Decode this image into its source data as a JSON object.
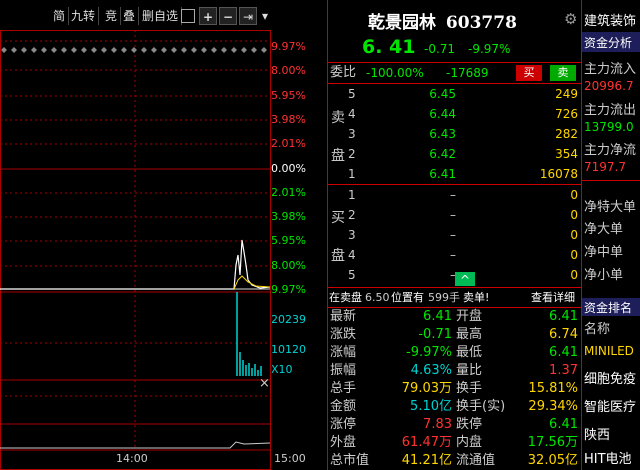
{
  "toolbar": {
    "btn1": "简",
    "btn2": "九转",
    "btn3": "竞",
    "btn4": "叠",
    "btn5": "删自选",
    "menu_icon": "menu-icon",
    "plus": "+",
    "minus": "−",
    "expand": "⇥",
    "dropdown": "▾"
  },
  "chart": {
    "y_labels_up": [
      "9.97%",
      "8.00%",
      "5.95%",
      "3.98%",
      "2.01%",
      "0.00%"
    ],
    "y_labels_down": [
      "2.01%",
      "3.98%",
      "5.95%",
      "8.00%",
      "9.97%"
    ],
    "vol_labels": [
      "20239",
      "10120",
      "X10"
    ],
    "time_labels": [
      "14:00",
      "15:00"
    ],
    "close_icon": "×"
  },
  "quote": {
    "name": "乾景园林",
    "code": "603778",
    "price": "6. 41",
    "change": "-0.71",
    "pct": "-9.97%",
    "weibi_label": "委比",
    "weibi_val": "-100.00%",
    "weicha_val": "-17689",
    "buy_btn": "买",
    "sell_btn": "卖",
    "sell_side": [
      "卖",
      "盘"
    ],
    "sells": [
      {
        "lvl": "5",
        "price": "6.45",
        "vol": "249"
      },
      {
        "lvl": "4",
        "price": "6.44",
        "vol": "726"
      },
      {
        "lvl": "3",
        "price": "6.43",
        "vol": "282"
      },
      {
        "lvl": "2",
        "price": "6.42",
        "vol": "354"
      },
      {
        "lvl": "1",
        "price": "6.41",
        "vol": "16078"
      }
    ],
    "buy_side": [
      "买",
      "盘"
    ],
    "buys": [
      {
        "lvl": "1",
        "price": "–",
        "vol": "0"
      },
      {
        "lvl": "2",
        "price": "–",
        "vol": "0"
      },
      {
        "lvl": "3",
        "price": "–",
        "vol": "0"
      },
      {
        "lvl": "4",
        "price": "–",
        "vol": "0"
      },
      {
        "lvl": "5",
        "price": "–",
        "vol": "0"
      }
    ],
    "caret": "^",
    "notice_pre": "在卖盘",
    "notice_price": "6.50",
    "notice_mid": "位置有",
    "notice_vol": "599手",
    "notice_post": "卖单!",
    "detail_link": "查看详细",
    "stats": [
      {
        "l1": "最新",
        "v1": "6.41",
        "l2": "开盘",
        "v2": "6.41"
      },
      {
        "l1": "涨跌",
        "v1": "-0.71",
        "l2": "最高",
        "v2": "6.74"
      },
      {
        "l1": "涨幅",
        "v1": "-9.97%",
        "l2": "最低",
        "v2": "6.41"
      },
      {
        "l1": "振幅",
        "v1": "4.63%",
        "l2": "量比",
        "v2": "1.37"
      },
      {
        "l1": "总手",
        "v1": "79.03万",
        "l2": "换手",
        "v2": "15.81%"
      },
      {
        "l1": "金额",
        "v1": "5.10亿",
        "l2": "换手(实)",
        "v2": "29.34%"
      },
      {
        "l1": "涨停",
        "v1": "7.83",
        "l2": "跌停",
        "v2": "6.41"
      },
      {
        "l1": "外盘",
        "v1": "61.47万",
        "l2": "内盘",
        "v2": "17.56万"
      },
      {
        "l1": "总市值",
        "v1": "41.21亿",
        "l2": "流通值",
        "v2": "32.05亿"
      }
    ]
  },
  "sidebar": {
    "top": "建筑装饰",
    "fund_title": "资金分析",
    "items": [
      "主力流入",
      "20996.7",
      "主力流出",
      "13799.0",
      "主力净流",
      "7197.7"
    ],
    "flows": [
      "净特大单",
      "净大单",
      "净中单",
      "净小单"
    ],
    "rank_title": "资金排名",
    "name_hdr": "名称",
    "ranks": [
      "MINILED",
      "细胞免疫",
      "智能医疗",
      "陕西",
      "HIT电池"
    ]
  }
}
